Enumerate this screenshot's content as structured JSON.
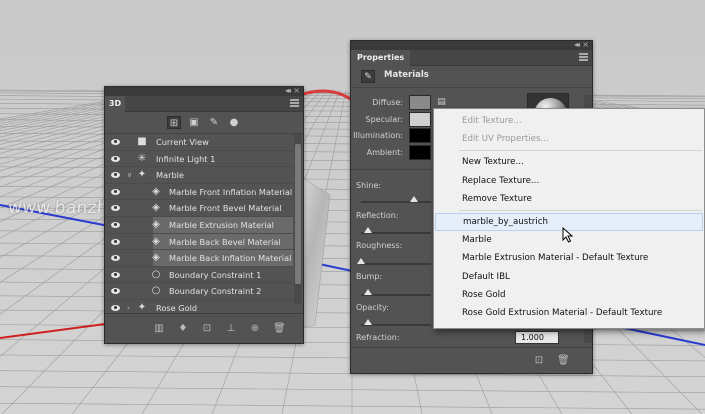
{
  "watermark": "www.banzhidiansheji.com",
  "panel3d": {
    "tab": "3D",
    "layers": [
      {
        "label": "Current View",
        "icon": "camera-icon",
        "depth": 0
      },
      {
        "label": "Infinite Light 1",
        "icon": "light-icon",
        "depth": 0
      },
      {
        "label": "Marble",
        "icon": "mesh-icon",
        "depth": 0,
        "expanded": true
      },
      {
        "label": "Marble Front Inflation Material",
        "icon": "material-icon",
        "depth": 1
      },
      {
        "label": "Marble Front Bevel Material",
        "icon": "material-icon",
        "depth": 1
      },
      {
        "label": "Marble Extrusion Material",
        "icon": "material-icon",
        "depth": 1,
        "selected": true
      },
      {
        "label": "Marble Back Bevel Material",
        "icon": "material-icon",
        "depth": 1,
        "selected": true
      },
      {
        "label": "Marble Back Inflation Material",
        "icon": "material-icon",
        "depth": 1,
        "selected": true
      },
      {
        "label": "Boundary Constraint 1",
        "icon": "constraint-icon",
        "depth": 1
      },
      {
        "label": "Boundary Constraint 2",
        "icon": "constraint-icon",
        "depth": 1
      },
      {
        "label": "Rose Gold",
        "icon": "mesh-icon",
        "depth": 0,
        "expanded": false
      }
    ]
  },
  "properties": {
    "tab": "Properties",
    "section": "Materials",
    "labels": {
      "diffuse": "Diffuse:",
      "specular": "Specular:",
      "illumination": "Illumination:",
      "ambient": "Ambient:",
      "shine": "Shine:",
      "reflection": "Reflection:",
      "roughness": "Roughness:",
      "bump": "Bump:",
      "opacity": "Opacity:",
      "refraction": "Refraction:"
    },
    "colors": {
      "diffuse": "#8a8a8a",
      "specular": "#d0d0d0",
      "illumination": "#000000",
      "ambient": "#000000"
    },
    "sliders": {
      "shine": 0.75,
      "reflection": 0.1,
      "roughness": 0.0,
      "bump": 0.1,
      "opacity": 0.1
    },
    "refraction_value": "1.000"
  },
  "context_menu": {
    "items": [
      {
        "label": "Edit Texture...",
        "disabled": true
      },
      {
        "label": "Edit UV Properties...",
        "disabled": true
      },
      {
        "separator": true
      },
      {
        "label": "New Texture..."
      },
      {
        "label": "Replace Texture..."
      },
      {
        "label": "Remove Texture"
      },
      {
        "separator": true
      },
      {
        "label": "marble_by_austrich",
        "highlighted": true
      },
      {
        "label": "Marble"
      },
      {
        "label": "Marble Extrusion Material - Default Texture"
      },
      {
        "label": "Default IBL"
      },
      {
        "label": "Rose Gold"
      },
      {
        "label": "Rose Gold Extrusion Material - Default Texture"
      }
    ]
  }
}
